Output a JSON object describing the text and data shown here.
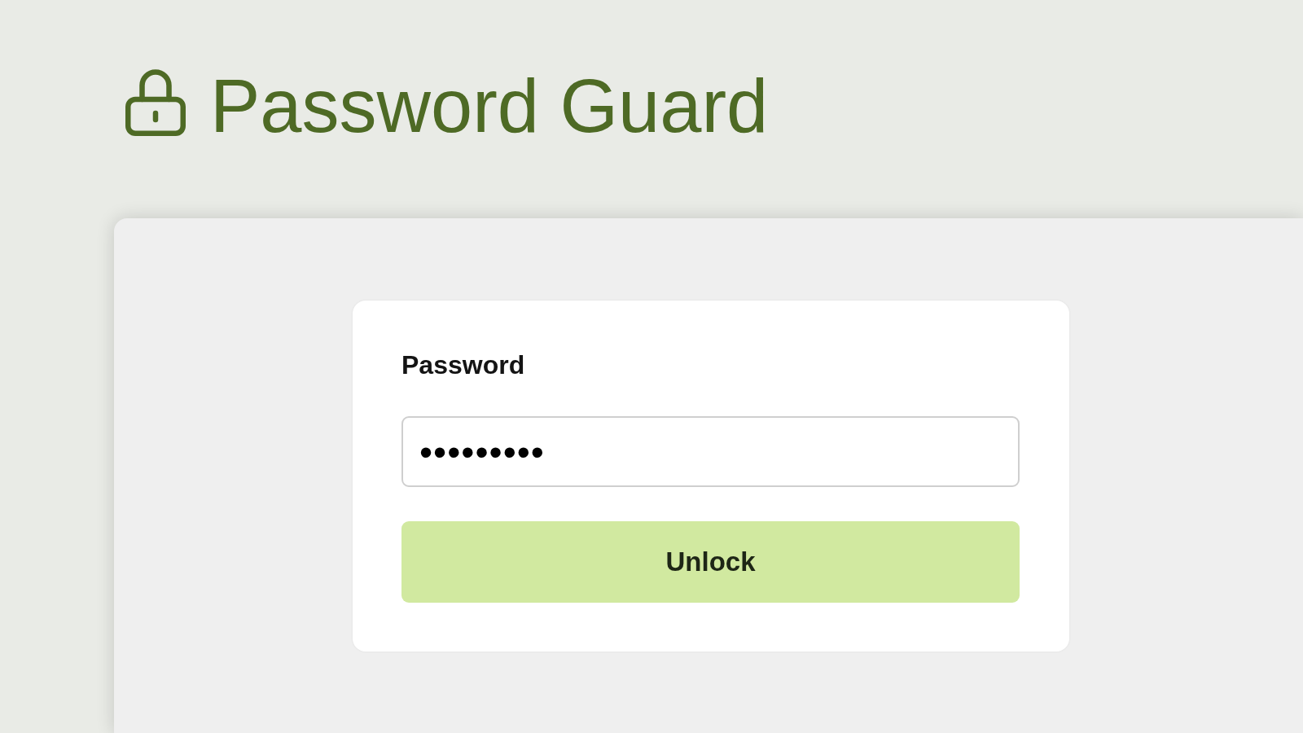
{
  "header": {
    "title": "Password Guard"
  },
  "unlock_form": {
    "label": "Password",
    "password": {
      "value": "•••••••••"
    },
    "button": "Unlock"
  }
}
